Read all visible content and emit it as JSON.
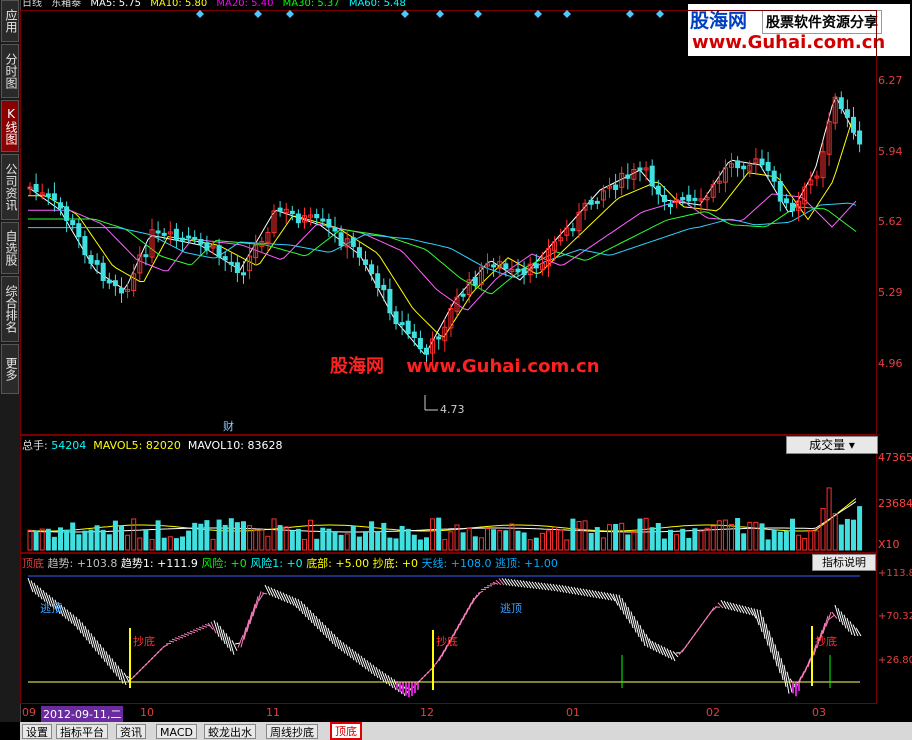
{
  "sidebar": {
    "items": [
      {
        "label": "应用"
      },
      {
        "label": "分时图"
      },
      {
        "label": "K线图",
        "active": true
      },
      {
        "label": "公司资讯"
      },
      {
        "label": "自选股"
      },
      {
        "label": "综合排名"
      },
      {
        "label": "更多"
      }
    ]
  },
  "header": {
    "title": "日线",
    "stock": "东箱泰",
    "ma": [
      {
        "label": "MA5: 5.75",
        "color": "#ffffff"
      },
      {
        "label": "MA10: 5.80",
        "color": "#ffff00"
      },
      {
        "label": "MA20: 5.40",
        "color": "#ff00ff"
      },
      {
        "label": "MA30: 5.37",
        "color": "#00ff00"
      },
      {
        "label": "MA60: 5.48",
        "color": "#00ffff"
      }
    ]
  },
  "banner": {
    "logo": "股海网",
    "slogan": "股票软件资源分享",
    "url": "www.Guhai.com.cn"
  },
  "watermark": {
    "site": "股海网",
    "url": "www.Guhai.com.cn"
  },
  "price_axis": [
    "6.27",
    "5.94",
    "5.62",
    "5.29",
    "4.96"
  ],
  "low_marker": "4.73",
  "event_marker": "财",
  "volume": {
    "header": [
      {
        "label": "总手: ",
        "value": "54204",
        "color": "#00ffff"
      },
      {
        "label": "MAVOL5: ",
        "value": "82020",
        "color": "#ffff00"
      },
      {
        "label": "MAVOL10: ",
        "value": "83628",
        "color": "#ffffff"
      }
    ],
    "dropdown": "成交量",
    "axis": [
      "47365",
      "23684",
      "X10"
    ]
  },
  "indicator": {
    "name": "顶底",
    "header": [
      {
        "label": "趋势: ",
        "value": "+103.8",
        "color": "#c0c0c0"
      },
      {
        "label": "趋势1: ",
        "value": "+111.9",
        "color": "#ffffff"
      },
      {
        "label": "风险: ",
        "value": "+0",
        "color": "#00ff00"
      },
      {
        "label": "风险1: ",
        "value": "+0",
        "color": "#00ffff"
      },
      {
        "label": "底部: ",
        "value": "+5.00",
        "color": "#ffff00"
      },
      {
        "label": "抄底: ",
        "value": "+0",
        "color": "#ffff00"
      },
      {
        "label": "天线: ",
        "value": "+108.0",
        "color": "#00aaff"
      },
      {
        "label": "逃顶: ",
        "value": "+1.00",
        "color": "#00aaff"
      }
    ],
    "explain": "指标说明",
    "axis": [
      "+113.8",
      "+70.32",
      "+26.80"
    ],
    "escape_label": "逃顶",
    "buy_label": "抄底"
  },
  "date_axis": {
    "labels": [
      "09",
      "10",
      "11",
      "12",
      "01",
      "02",
      "03"
    ],
    "cursor": "2012-09-11,二"
  },
  "tabs": [
    {
      "label": "设置"
    },
    {
      "label": "指标平台"
    },
    {
      "label": "资讯"
    },
    {
      "label": "MACD"
    },
    {
      "label": "蛟龙出水"
    },
    {
      "label": "周线抄底"
    },
    {
      "label": "顶底",
      "active": true
    }
  ]
}
